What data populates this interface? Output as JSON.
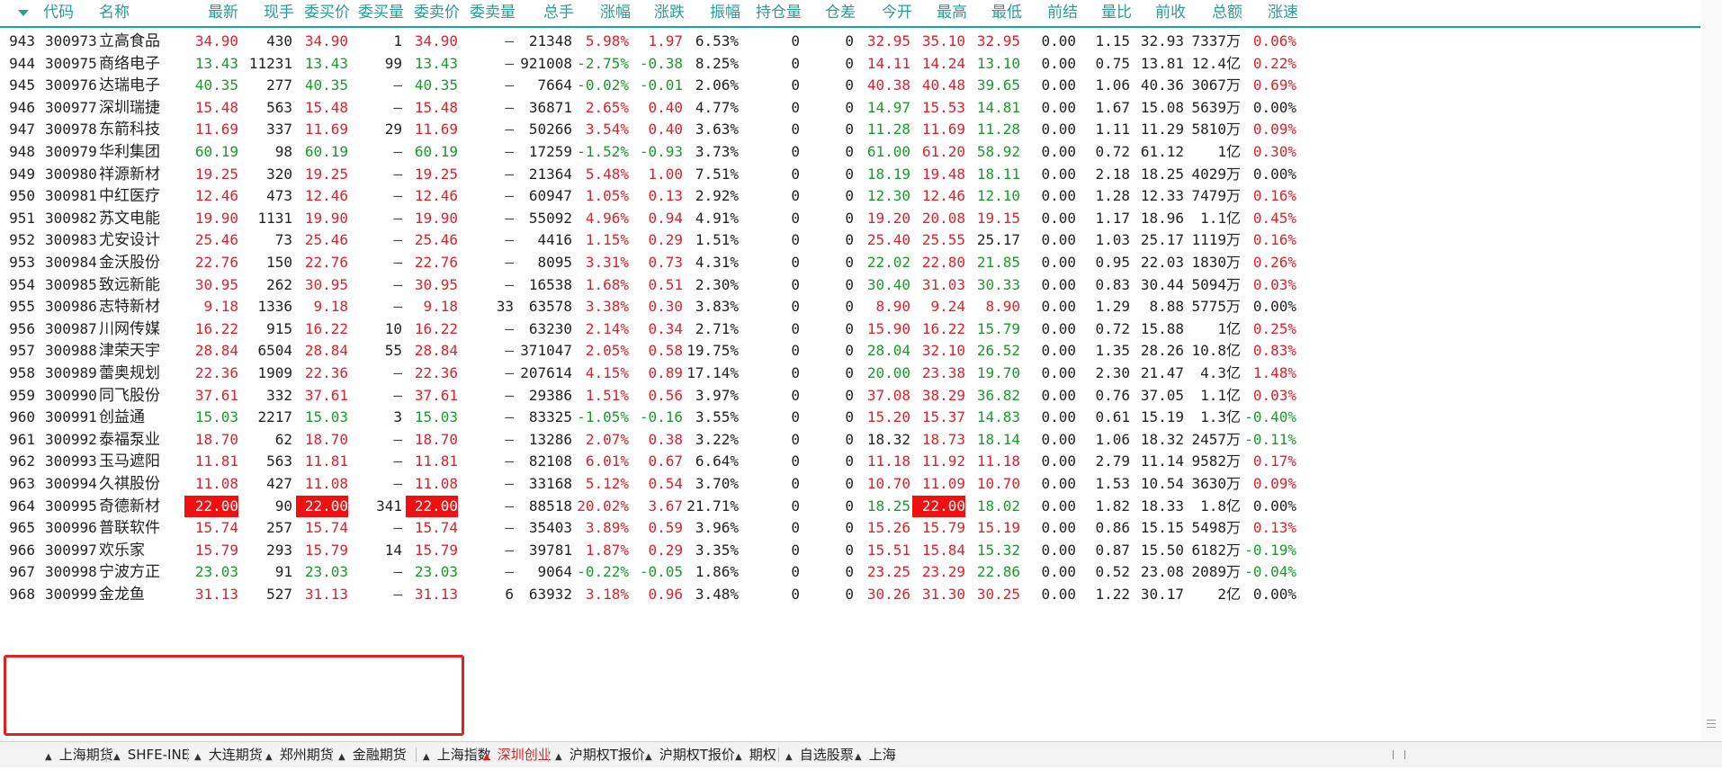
{
  "columns": [
    "代码",
    "名称",
    "最新",
    "现手",
    "委买价",
    "委买量",
    "委卖价",
    "委卖量",
    "总手",
    "涨幅",
    "涨跌",
    "振幅",
    "持仓量",
    "仓差",
    "今开",
    "最高",
    "最低",
    "前结",
    "量比",
    "前收",
    "总额",
    "涨速"
  ],
  "rows": [
    {
      "idx": "943",
      "code": "300973",
      "name": "立高食品",
      "last": "34.90",
      "vol": "430",
      "bid": "34.90",
      "bidv": "1",
      "ask": "34.90",
      "askv": "—",
      "total": "21348",
      "pct": "5.98%",
      "chg": "1.97",
      "amp": "6.53%",
      "oi": "0",
      "oid": "0",
      "open": "32.95",
      "high": "35.10",
      "low": "32.95",
      "pset": "0.00",
      "vr": "1.15",
      "prev": "32.93",
      "amt": "7337万",
      "speed": "0.06%"
    },
    {
      "idx": "944",
      "code": "300975",
      "name": "商络电子",
      "last": "13.43",
      "vol": "11231",
      "bid": "13.43",
      "bidv": "99",
      "ask": "13.43",
      "askv": "—",
      "total": "921008",
      "pct": "-2.75%",
      "chg": "-0.38",
      "amp": "8.25%",
      "oi": "0",
      "oid": "0",
      "open": "14.11",
      "high": "14.24",
      "low": "13.10",
      "pset": "0.00",
      "vr": "0.75",
      "prev": "13.81",
      "amt": "12.4亿",
      "speed": "0.22%"
    },
    {
      "idx": "945",
      "code": "300976",
      "name": "达瑞电子",
      "last": "40.35",
      "vol": "277",
      "bid": "40.35",
      "bidv": "—",
      "ask": "40.35",
      "askv": "—",
      "total": "7664",
      "pct": "-0.02%",
      "chg": "-0.01",
      "amp": "2.06%",
      "oi": "0",
      "oid": "0",
      "open": "40.38",
      "high": "40.48",
      "low": "39.65",
      "pset": "0.00",
      "vr": "1.06",
      "prev": "40.36",
      "amt": "3067万",
      "speed": "0.69%"
    },
    {
      "idx": "946",
      "code": "300977",
      "name": "深圳瑞捷",
      "last": "15.48",
      "vol": "563",
      "bid": "15.48",
      "bidv": "—",
      "ask": "15.48",
      "askv": "—",
      "total": "36871",
      "pct": "2.65%",
      "chg": "0.40",
      "amp": "4.77%",
      "oi": "0",
      "oid": "0",
      "open": "14.97",
      "high": "15.53",
      "low": "14.81",
      "pset": "0.00",
      "vr": "1.67",
      "prev": "15.08",
      "amt": "5639万",
      "speed": "0.00%"
    },
    {
      "idx": "947",
      "code": "300978",
      "name": "东箭科技",
      "last": "11.69",
      "vol": "337",
      "bid": "11.69",
      "bidv": "29",
      "ask": "11.69",
      "askv": "—",
      "total": "50266",
      "pct": "3.54%",
      "chg": "0.40",
      "amp": "3.63%",
      "oi": "0",
      "oid": "0",
      "open": "11.28",
      "high": "11.69",
      "low": "11.28",
      "pset": "0.00",
      "vr": "1.11",
      "prev": "11.29",
      "amt": "5810万",
      "speed": "0.09%"
    },
    {
      "idx": "948",
      "code": "300979",
      "name": "华利集团",
      "last": "60.19",
      "vol": "98",
      "bid": "60.19",
      "bidv": "—",
      "ask": "60.19",
      "askv": "—",
      "total": "17259",
      "pct": "-1.52%",
      "chg": "-0.93",
      "amp": "3.73%",
      "oi": "0",
      "oid": "0",
      "open": "61.00",
      "high": "61.20",
      "low": "58.92",
      "pset": "0.00",
      "vr": "0.72",
      "prev": "61.12",
      "amt": "1亿",
      "speed": "0.30%"
    },
    {
      "idx": "949",
      "code": "300980",
      "name": "祥源新材",
      "last": "19.25",
      "vol": "320",
      "bid": "19.25",
      "bidv": "—",
      "ask": "19.25",
      "askv": "—",
      "total": "21364",
      "pct": "5.48%",
      "chg": "1.00",
      "amp": "7.51%",
      "oi": "0",
      "oid": "0",
      "open": "18.19",
      "high": "19.48",
      "low": "18.11",
      "pset": "0.00",
      "vr": "2.18",
      "prev": "18.25",
      "amt": "4029万",
      "speed": "0.00%"
    },
    {
      "idx": "950",
      "code": "300981",
      "name": "中红医疗",
      "last": "12.46",
      "vol": "473",
      "bid": "12.46",
      "bidv": "—",
      "ask": "12.46",
      "askv": "—",
      "total": "60947",
      "pct": "1.05%",
      "chg": "0.13",
      "amp": "2.92%",
      "oi": "0",
      "oid": "0",
      "open": "12.30",
      "high": "12.46",
      "low": "12.10",
      "pset": "0.00",
      "vr": "1.28",
      "prev": "12.33",
      "amt": "7479万",
      "speed": "0.16%"
    },
    {
      "idx": "951",
      "code": "300982",
      "name": "苏文电能",
      "last": "19.90",
      "vol": "1131",
      "bid": "19.90",
      "bidv": "—",
      "ask": "19.90",
      "askv": "—",
      "total": "55092",
      "pct": "4.96%",
      "chg": "0.94",
      "amp": "4.91%",
      "oi": "0",
      "oid": "0",
      "open": "19.20",
      "high": "20.08",
      "low": "19.15",
      "pset": "0.00",
      "vr": "1.17",
      "prev": "18.96",
      "amt": "1.1亿",
      "speed": "0.45%"
    },
    {
      "idx": "952",
      "code": "300983",
      "name": "尤安设计",
      "last": "25.46",
      "vol": "73",
      "bid": "25.46",
      "bidv": "—",
      "ask": "25.46",
      "askv": "—",
      "total": "4416",
      "pct": "1.15%",
      "chg": "0.29",
      "amp": "1.51%",
      "oi": "0",
      "oid": "0",
      "open": "25.40",
      "high": "25.55",
      "low": "25.17",
      "pset": "0.00",
      "vr": "1.03",
      "prev": "25.17",
      "amt": "1119万",
      "speed": "0.16%"
    },
    {
      "idx": "953",
      "code": "300984",
      "name": "金沃股份",
      "last": "22.76",
      "vol": "150",
      "bid": "22.76",
      "bidv": "—",
      "ask": "22.76",
      "askv": "—",
      "total": "8095",
      "pct": "3.31%",
      "chg": "0.73",
      "amp": "4.31%",
      "oi": "0",
      "oid": "0",
      "open": "22.02",
      "high": "22.80",
      "low": "21.85",
      "pset": "0.00",
      "vr": "0.95",
      "prev": "22.03",
      "amt": "1830万",
      "speed": "0.26%"
    },
    {
      "idx": "954",
      "code": "300985",
      "name": "致远新能",
      "last": "30.95",
      "vol": "262",
      "bid": "30.95",
      "bidv": "—",
      "ask": "30.95",
      "askv": "—",
      "total": "16538",
      "pct": "1.68%",
      "chg": "0.51",
      "amp": "2.30%",
      "oi": "0",
      "oid": "0",
      "open": "30.40",
      "high": "31.03",
      "low": "30.33",
      "pset": "0.00",
      "vr": "0.83",
      "prev": "30.44",
      "amt": "5094万",
      "speed": "0.03%"
    },
    {
      "idx": "955",
      "code": "300986",
      "name": "志特新材",
      "last": "9.18",
      "vol": "1336",
      "bid": "9.18",
      "bidv": "—",
      "ask": "9.18",
      "askv": "33",
      "total": "63578",
      "pct": "3.38%",
      "chg": "0.30",
      "amp": "3.83%",
      "oi": "0",
      "oid": "0",
      "open": "8.90",
      "high": "9.24",
      "low": "8.90",
      "pset": "0.00",
      "vr": "1.29",
      "prev": "8.88",
      "amt": "5775万",
      "speed": "0.00%"
    },
    {
      "idx": "956",
      "code": "300987",
      "name": "川网传媒",
      "last": "16.22",
      "vol": "915",
      "bid": "16.22",
      "bidv": "10",
      "ask": "16.22",
      "askv": "—",
      "total": "63230",
      "pct": "2.14%",
      "chg": "0.34",
      "amp": "2.71%",
      "oi": "0",
      "oid": "0",
      "open": "15.90",
      "high": "16.22",
      "low": "15.79",
      "pset": "0.00",
      "vr": "0.72",
      "prev": "15.88",
      "amt": "1亿",
      "speed": "0.25%"
    },
    {
      "idx": "957",
      "code": "300988",
      "name": "津荣天宇",
      "last": "28.84",
      "vol": "6504",
      "bid": "28.84",
      "bidv": "55",
      "ask": "28.84",
      "askv": "—",
      "total": "371047",
      "pct": "2.05%",
      "chg": "0.58",
      "amp": "19.75%",
      "oi": "0",
      "oid": "0",
      "open": "28.04",
      "high": "32.10",
      "low": "26.52",
      "pset": "0.00",
      "vr": "1.35",
      "prev": "28.26",
      "amt": "10.8亿",
      "speed": "0.83%"
    },
    {
      "idx": "958",
      "code": "300989",
      "name": "蕾奥规划",
      "last": "22.36",
      "vol": "1909",
      "bid": "22.36",
      "bidv": "—",
      "ask": "22.36",
      "askv": "—",
      "total": "207614",
      "pct": "4.15%",
      "chg": "0.89",
      "amp": "17.14%",
      "oi": "0",
      "oid": "0",
      "open": "20.00",
      "high": "23.38",
      "low": "19.70",
      "pset": "0.00",
      "vr": "2.30",
      "prev": "21.47",
      "amt": "4.3亿",
      "speed": "1.48%"
    },
    {
      "idx": "959",
      "code": "300990",
      "name": "同飞股份",
      "last": "37.61",
      "vol": "332",
      "bid": "37.61",
      "bidv": "—",
      "ask": "37.61",
      "askv": "—",
      "total": "29386",
      "pct": "1.51%",
      "chg": "0.56",
      "amp": "3.97%",
      "oi": "0",
      "oid": "0",
      "open": "37.08",
      "high": "38.29",
      "low": "36.82",
      "pset": "0.00",
      "vr": "0.76",
      "prev": "37.05",
      "amt": "1.1亿",
      "speed": "0.03%"
    },
    {
      "idx": "960",
      "code": "300991",
      "name": "创益通",
      "last": "15.03",
      "vol": "2217",
      "bid": "15.03",
      "bidv": "3",
      "ask": "15.03",
      "askv": "—",
      "total": "83325",
      "pct": "-1.05%",
      "chg": "-0.16",
      "amp": "3.55%",
      "oi": "0",
      "oid": "0",
      "open": "15.20",
      "high": "15.37",
      "low": "14.83",
      "pset": "0.00",
      "vr": "0.61",
      "prev": "15.19",
      "amt": "1.3亿",
      "speed": "-0.40%"
    },
    {
      "idx": "961",
      "code": "300992",
      "name": "泰福泵业",
      "last": "18.70",
      "vol": "62",
      "bid": "18.70",
      "bidv": "—",
      "ask": "18.70",
      "askv": "—",
      "total": "13286",
      "pct": "2.07%",
      "chg": "0.38",
      "amp": "3.22%",
      "oi": "0",
      "oid": "0",
      "open": "18.32",
      "high": "18.73",
      "low": "18.14",
      "pset": "0.00",
      "vr": "1.06",
      "prev": "18.32",
      "amt": "2457万",
      "speed": "-0.11%"
    },
    {
      "idx": "962",
      "code": "300993",
      "name": "玉马遮阳",
      "last": "11.81",
      "vol": "563",
      "bid": "11.81",
      "bidv": "—",
      "ask": "11.81",
      "askv": "—",
      "total": "82108",
      "pct": "6.01%",
      "chg": "0.67",
      "amp": "6.64%",
      "oi": "0",
      "oid": "0",
      "open": "11.18",
      "high": "11.92",
      "low": "11.18",
      "pset": "0.00",
      "vr": "2.79",
      "prev": "11.14",
      "amt": "9582万",
      "speed": "0.17%"
    },
    {
      "idx": "963",
      "code": "300994",
      "name": "久祺股份",
      "last": "11.08",
      "vol": "427",
      "bid": "11.08",
      "bidv": "—",
      "ask": "11.08",
      "askv": "—",
      "total": "33168",
      "pct": "5.12%",
      "chg": "0.54",
      "amp": "3.70%",
      "oi": "0",
      "oid": "0",
      "open": "10.70",
      "high": "11.09",
      "low": "10.70",
      "pset": "0.00",
      "vr": "1.53",
      "prev": "10.54",
      "amt": "3630万",
      "speed": "0.09%"
    },
    {
      "idx": "964",
      "code": "300995",
      "name": "奇德新材",
      "last": "22.00",
      "vol": "90",
      "bid": "22.00",
      "bidv": "341",
      "ask": "22.00",
      "askv": "—",
      "total": "88518",
      "pct": "20.02%",
      "chg": "3.67",
      "amp": "21.71%",
      "oi": "0",
      "oid": "0",
      "open": "18.25",
      "high": "22.00",
      "low": "18.02",
      "pset": "0.00",
      "vr": "1.82",
      "prev": "18.33",
      "amt": "1.8亿",
      "speed": "0.00%",
      "limit_up": true
    },
    {
      "idx": "965",
      "code": "300996",
      "name": "普联软件",
      "last": "15.74",
      "vol": "257",
      "bid": "15.74",
      "bidv": "—",
      "ask": "15.74",
      "askv": "—",
      "total": "35403",
      "pct": "3.89%",
      "chg": "0.59",
      "amp": "3.96%",
      "oi": "0",
      "oid": "0",
      "open": "15.26",
      "high": "15.79",
      "low": "15.19",
      "pset": "0.00",
      "vr": "0.86",
      "prev": "15.15",
      "amt": "5498万",
      "speed": "0.13%"
    },
    {
      "idx": "966",
      "code": "300997",
      "name": "欢乐家",
      "last": "15.79",
      "vol": "293",
      "bid": "15.79",
      "bidv": "14",
      "ask": "15.79",
      "askv": "—",
      "total": "39781",
      "pct": "1.87%",
      "chg": "0.29",
      "amp": "3.35%",
      "oi": "0",
      "oid": "0",
      "open": "15.51",
      "high": "15.84",
      "low": "15.32",
      "pset": "0.00",
      "vr": "0.87",
      "prev": "15.50",
      "amt": "6182万",
      "speed": "-0.19%"
    },
    {
      "idx": "967",
      "code": "300998",
      "name": "宁波方正",
      "last": "23.03",
      "vol": "91",
      "bid": "23.03",
      "bidv": "—",
      "ask": "23.03",
      "askv": "—",
      "total": "9064",
      "pct": "-0.22%",
      "chg": "-0.05",
      "amp": "1.86%",
      "oi": "0",
      "oid": "0",
      "open": "23.25",
      "high": "23.29",
      "low": "22.86",
      "pset": "0.00",
      "vr": "0.52",
      "prev": "23.08",
      "amt": "2089万",
      "speed": "-0.04%"
    },
    {
      "idx": "968",
      "code": "300999",
      "name": "金龙鱼",
      "last": "31.13",
      "vol": "527",
      "bid": "31.13",
      "bidv": "—",
      "ask": "31.13",
      "askv": "6",
      "total": "63932",
      "pct": "3.18%",
      "chg": "0.96",
      "amp": "3.48%",
      "oi": "0",
      "oid": "0",
      "open": "30.26",
      "high": "31.30",
      "low": "30.25",
      "pset": "0.00",
      "vr": "1.22",
      "prev": "30.17",
      "amt": "2亿",
      "speed": "0.00%"
    }
  ],
  "tabs": [
    {
      "label": "上海期货",
      "active": false
    },
    {
      "label": "SHFE-INE",
      "active": false
    },
    {
      "label": "大连期货",
      "active": false
    },
    {
      "label": "郑州期货",
      "active": false
    },
    {
      "label": "金融期货",
      "active": false
    },
    {
      "label": "上海指数",
      "active": false
    },
    {
      "label": "深圳创业",
      "active": true
    },
    {
      "label": "沪期权T报价",
      "active": false
    },
    {
      "label": "沪期权T报价",
      "active": false
    },
    {
      "label": "期权",
      "active": false
    },
    {
      "label": "自选股票",
      "active": false
    },
    {
      "label": "上海",
      "active": false
    }
  ],
  "colors": {
    "up": "#e0202a",
    "down": "#1a9a2a",
    "header": "#2a9d94",
    "highlight": "#ee1111",
    "selection_box": "#e62020"
  }
}
